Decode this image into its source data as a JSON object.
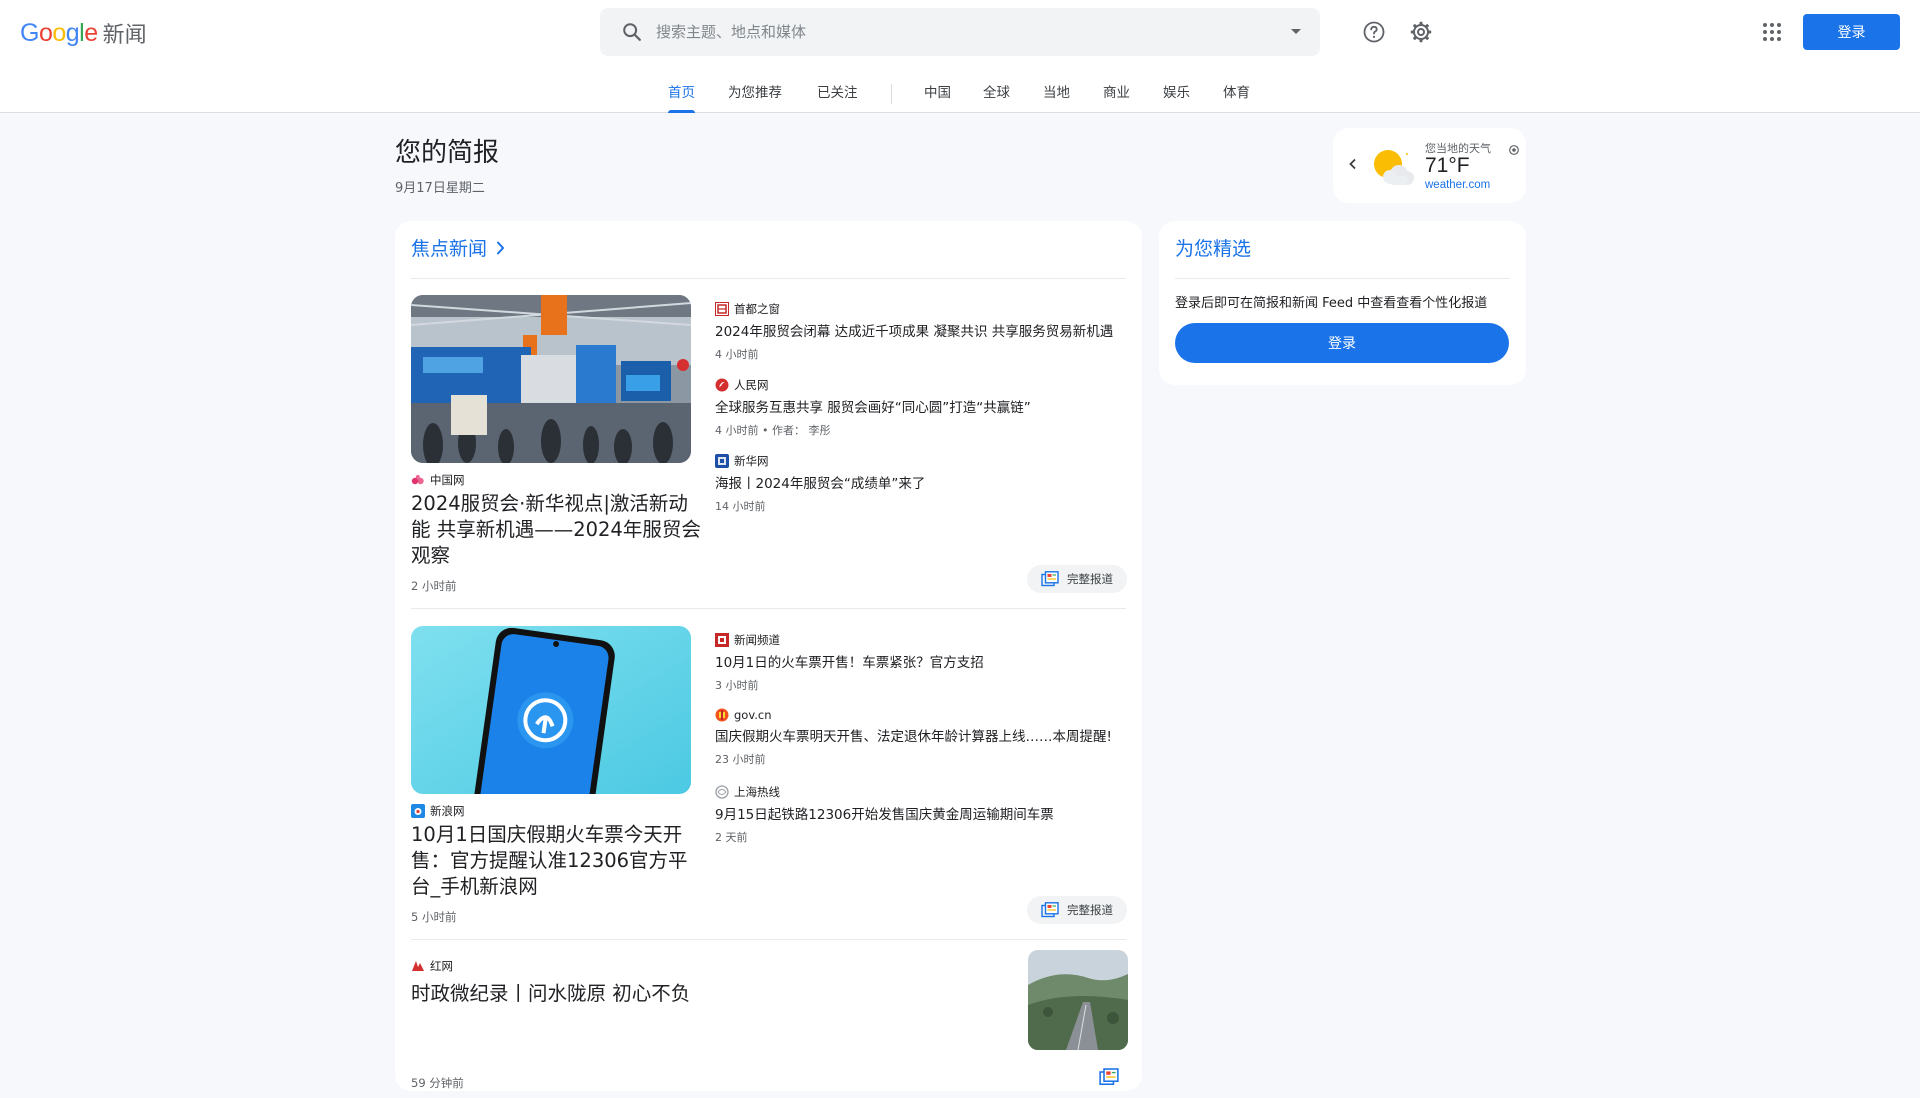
{
  "header": {
    "logo": {
      "letters": [
        {
          "ch": "G",
          "color": "#4285F4"
        },
        {
          "ch": "o",
          "color": "#EA4335"
        },
        {
          "ch": "o",
          "color": "#FBBC05"
        },
        {
          "ch": "g",
          "color": "#4285F4"
        },
        {
          "ch": "l",
          "color": "#34A853"
        },
        {
          "ch": "e",
          "color": "#EA4335"
        }
      ],
      "product": "新闻"
    },
    "search": {
      "placeholder": "搜索主题、地点和媒体",
      "value": "",
      "icon": "search-icon",
      "dropdown_icon": "caret-down-icon"
    },
    "help_icon": "help-circle-icon",
    "settings_icon": "gear-icon",
    "apps_icon": "apps-grid-icon",
    "signin_label": "登录"
  },
  "tabs": [
    {
      "label": "首页",
      "active": true
    },
    {
      "label": "为您推荐",
      "active": false
    },
    {
      "label": "已关注",
      "active": false
    },
    {
      "label": "中国",
      "active": false
    },
    {
      "label": "全球",
      "active": false
    },
    {
      "label": "当地",
      "active": false
    },
    {
      "label": "商业",
      "active": false
    },
    {
      "label": "娱乐",
      "active": false
    },
    {
      "label": "体育",
      "active": false
    }
  ],
  "briefing": {
    "title": "您的简报",
    "date": "9月17日星期二"
  },
  "weather": {
    "label": "您当地的天气",
    "temp": "71°F",
    "source": "weather.com",
    "icon": "partly-cloudy-icon"
  },
  "top_stories": {
    "title": "焦点新闻",
    "clusters": [
      {
        "hero": {
          "source": "中国网",
          "title": "2024服贸会·新华视点|激活新动能 共享新机遇——2024年服贸会观察",
          "time": "2 小时前"
        },
        "related": [
          {
            "source": "首都之窗",
            "title": "2024年服贸会闭幕 达成近千项成果 凝聚共识 共享服务贸易新机遇",
            "time": "4 小时前"
          },
          {
            "source": "人民网",
            "title": "全球服务互惠共享 服贸会画好“同心圆”打造“共赢链”",
            "time": "4 小时前 • 作者： 李彤"
          },
          {
            "source": "新华网",
            "title": "海报丨2024年服贸会“成绩单”来了",
            "time": "14 小时前"
          }
        ],
        "full_coverage": "完整报道"
      },
      {
        "hero": {
          "source": "新浪网",
          "title": "10月1日国庆假期火车票今天开售：官方提醒认准12306官方平台_手机新浪网",
          "time": "5 小时前"
        },
        "related": [
          {
            "source": "新闻频道",
            "title": "10月1日的火车票开售！车票紧张？官方支招",
            "time": "3 小时前"
          },
          {
            "source": "gov.cn",
            "title": "国庆假期火车票明天开售、法定退休年龄计算器上线……本周提醒!",
            "time": "23 小时前"
          },
          {
            "source": "上海热线",
            "title": "9月15日起铁路12306开始发售国庆黄金周运输期间车票",
            "time": "2 天前"
          }
        ],
        "full_coverage": "完整报道"
      }
    ],
    "single": {
      "source": "红网",
      "title": "时政微纪录丨问水陇原 初心不负",
      "time": "59 分钟前"
    }
  },
  "picks": {
    "title": "为您精选",
    "text": "登录后即可在简报和新闻 Feed 中查看查看个性化报道",
    "button": "登录"
  },
  "colors": {
    "accent": "#1a73e8",
    "background": "#f6f8fc",
    "card": "#ffffff"
  }
}
